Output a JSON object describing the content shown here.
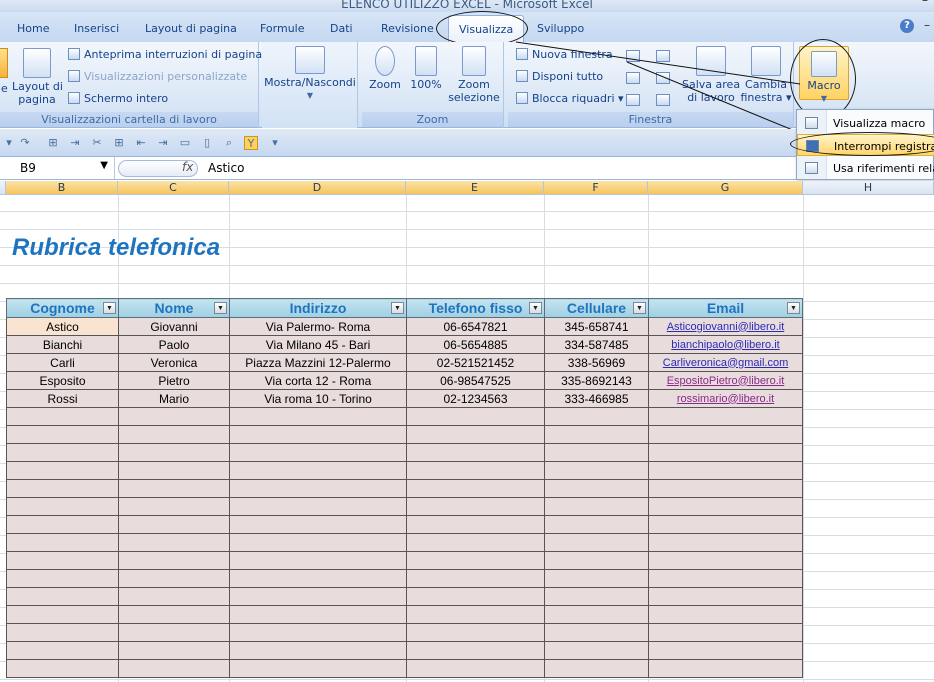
{
  "window": {
    "title": "ELENCO UTILIZZO EXCEL - Microsoft Excel",
    "minimize": "–"
  },
  "tabs": [
    "Home",
    "Inserisci",
    "Layout di pagina",
    "Formule",
    "Dati",
    "Revisione",
    "Visualizza",
    "Sviluppo"
  ],
  "active_tab": "Visualizza",
  "ribbon": {
    "views": {
      "partial_label": "le",
      "layout_label_1": "Layout di",
      "layout_label_2": "pagina",
      "preview_breaks": "Anteprima interruzioni di pagina",
      "custom_views": "Visualizzazioni personalizzate",
      "full_screen": "Schermo intero",
      "group_label": "Visualizzazioni cartella di lavoro"
    },
    "show_hide": {
      "label": "Mostra/Nascondi"
    },
    "zoom": {
      "zoom": "Zoom",
      "hundred": "100%",
      "zoom_sel_1": "Zoom",
      "zoom_sel_2": "selezione",
      "group_label": "Zoom"
    },
    "window": {
      "new_window": "Nuova finestra",
      "arrange_all": "Disponi tutto",
      "freeze": "Blocca riquadri",
      "save_ws_1": "Salva area",
      "save_ws_2": "di lavoro",
      "switch_1": "Cambia",
      "switch_2": "finestra",
      "group_label": "Finestra"
    },
    "macro": {
      "label": "Macro"
    }
  },
  "macro_menu": {
    "items": [
      "Visualizza macro",
      "Interrompi registrazione",
      "Usa riferimenti relativi"
    ],
    "highlighted": 1
  },
  "formula_bar": {
    "name_box": "B9",
    "fx": "fx",
    "value": "Astico"
  },
  "sheet": {
    "columns": [
      "B",
      "C",
      "D",
      "E",
      "F",
      "G",
      "H"
    ],
    "selected_columns": [
      "B",
      "C",
      "D",
      "E",
      "F",
      "G"
    ],
    "title": "Rubrica telefonica",
    "headers": [
      "Cognome",
      "Nome",
      "Indirizzo",
      "Telefono fisso",
      "Cellulare",
      "Email"
    ],
    "rows": [
      [
        "Astico",
        "Giovanni",
        "Via Palermo- Roma",
        "06-6547821",
        "345-658741",
        "Asticogiovanni@libero.it"
      ],
      [
        "Bianchi",
        "Paolo",
        "Via Milano 45 - Bari",
        "06-5654885",
        "334-587485",
        "bianchipaolo@libero.it"
      ],
      [
        "Carli",
        "Veronica",
        "Piazza Mazzini 12-Palermo",
        "02-521521452",
        "338-56969",
        "Carliveronica@gmail.com"
      ],
      [
        "Esposito",
        "Pietro",
        "Via corta 12 - Roma",
        "06-98547525",
        "335-8692143",
        "EspositoPietro@libero.it"
      ],
      [
        "Rossi",
        "Mario",
        "Via roma 10 - Torino",
        "02-1234563",
        "333-466985",
        "rossimario@libero.it"
      ]
    ],
    "empty_rows": 15,
    "colors": {
      "title": "#1f74bf",
      "header_bg": "#9fd0e4",
      "row_bg": "#e8dcdc",
      "selection": "#f5c55b"
    }
  }
}
